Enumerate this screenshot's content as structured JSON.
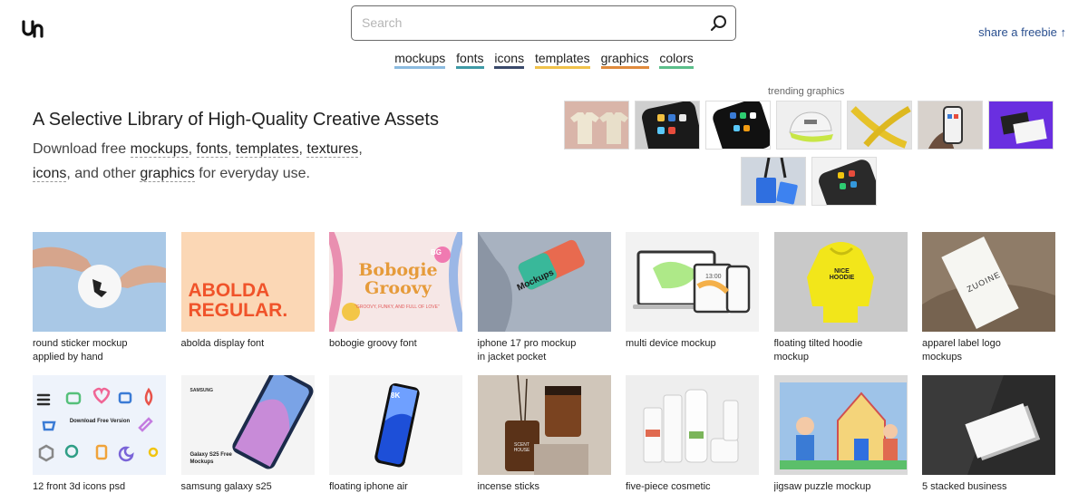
{
  "header": {
    "logo_text": "un",
    "search_placeholder": "Search",
    "share_link": "share a freebie ↑"
  },
  "nav": {
    "items": [
      {
        "label": "mockups",
        "color": "#8bbbe0"
      },
      {
        "label": "fonts",
        "color": "#3f9aa6"
      },
      {
        "label": "icons",
        "color": "#3a4a6b"
      },
      {
        "label": "templates",
        "color": "#f0c24a"
      },
      {
        "label": "graphics",
        "color": "#e08a3c"
      },
      {
        "label": "colors",
        "color": "#5bbf8a"
      }
    ]
  },
  "hero": {
    "headline": "A Selective Library of High-Quality Creative Assets",
    "sub_prefix": "Download free ",
    "link_mockups": "mockups",
    "sep1": ", ",
    "link_fonts": "fonts",
    "sep2": ", ",
    "link_templates": "templates",
    "sep3": ", ",
    "link_textures": "textures",
    "sep4": ",",
    "link_icons": "icons",
    "sub_middle": ", and other ",
    "link_graphics": "graphics",
    "sub_suffix": " for everyday use."
  },
  "trending": {
    "label": "trending graphics",
    "thumbs": [
      "t-shirt-icon",
      "phone-icon",
      "phone-icon",
      "cap-icon",
      "lanyard-icon",
      "phone-icon",
      "card-icon",
      "badge-icon",
      "phone-icon"
    ]
  },
  "cards": [
    {
      "line1": "round sticker mockup",
      "line2": "applied by hand"
    },
    {
      "line1": "abolda display font",
      "line2": ""
    },
    {
      "line1": "bobogie groovy font",
      "line2": ""
    },
    {
      "line1": "iphone 17 pro mockup",
      "line2": "in jacket pocket"
    },
    {
      "line1": "multi device mockup",
      "line2": ""
    },
    {
      "line1": "floating tilted hoodie",
      "line2": "mockup"
    },
    {
      "line1": "apparel label logo",
      "line2": "mockups"
    },
    {
      "line1": "12 front 3d icons psd",
      "line2": ""
    },
    {
      "line1": "samsung galaxy s25",
      "line2": ""
    },
    {
      "line1": "floating iphone air",
      "line2": ""
    },
    {
      "line1": "incense sticks",
      "line2": ""
    },
    {
      "line1": "five-piece cosmetic",
      "line2": ""
    },
    {
      "line1": "jigsaw puzzle mockup",
      "line2": ""
    },
    {
      "line1": "5 stacked business",
      "line2": ""
    }
  ],
  "image_text": {
    "abolda": "ABOLDA REGULAR.",
    "bobogie": "Bobogie Groovy",
    "bobogie_tag": "“GROOVY, FUNKY, AND FULL OF LOVE”",
    "bobogie_badge": "BG",
    "jacket_phone": "Mockups",
    "device_time": "13:00",
    "hoodie_text": "NICE HOODIE",
    "label_brand": "ZUOINE",
    "icons_title": "Download Free Version",
    "samsung_brand": "SAMSUNG",
    "samsung_title": "Galaxy S25 Free Mockups",
    "iphone_8k": "8K",
    "incense_label": "SCENT HOUSE"
  },
  "colors": {
    "link_blue": "#2a4f8f",
    "abolda_bg": "#fbd7b5",
    "abolda_text": "#f0532a",
    "trend_purple": "#6a2fe0",
    "hoodie_yellow": "#f2e61a"
  }
}
